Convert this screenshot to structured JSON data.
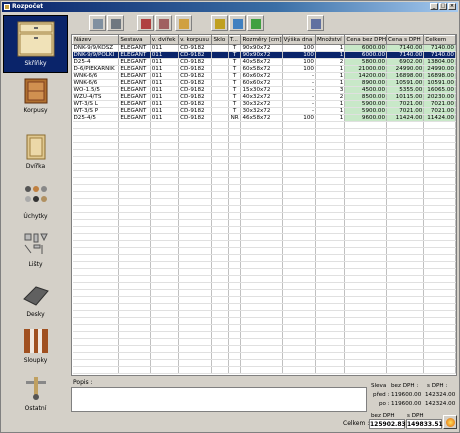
{
  "window": {
    "title": "Rozpočet"
  },
  "sidebar": {
    "items": [
      {
        "label": "Skříňky",
        "active": true
      },
      {
        "label": "Korpusy"
      },
      {
        "label": "Dvířka"
      },
      {
        "label": "Úchytky"
      },
      {
        "label": "Lišty"
      },
      {
        "label": "Desky"
      },
      {
        "label": "Sloupky"
      },
      {
        "label": "Ostatní"
      }
    ]
  },
  "table": {
    "columns": [
      "Název",
      "Sestava",
      "v. dvířek",
      "v. korpusu",
      "Sklo",
      "T...",
      "Rozměry [cm]",
      "Výška dna",
      "Množství",
      "Cena bez DPH",
      "Cena s DPH",
      "Celkem"
    ],
    "rows": [
      [
        "DNK-9/9/KOSZ",
        "ELEGANT",
        "011",
        "CD-9182",
        "",
        "T",
        "90x90x72",
        "100",
        "1",
        "6000.00",
        "7140.00",
        "7140.00"
      ],
      [
        "DNK-9/9/POLKI",
        "ELEGANT",
        "011",
        "CD-9182",
        "",
        "T",
        "90x90x72",
        "100",
        "1",
        "6000.00",
        "7140.00",
        "7140.00"
      ],
      [
        "D25-4",
        "ELEGANT",
        "011",
        "CD-9182",
        "",
        "T",
        "40x58x72",
        "100",
        "2",
        "5800.00",
        "6902.00",
        "13804.00"
      ],
      [
        "D-6/PIEKARNIK",
        "ELEGANT",
        "011",
        "CD-9182",
        "",
        "T",
        "60x58x72",
        "100",
        "1",
        "21000.00",
        "24990.00",
        "24990.00"
      ],
      [
        "WNK-6/6",
        "ELEGANT",
        "011",
        "CD-9182",
        "",
        "T",
        "60x60x72",
        "-",
        "1",
        "14200.00",
        "16898.00",
        "16898.00"
      ],
      [
        "WNK-6/6",
        "ELEGANT",
        "011",
        "CD-9182",
        "",
        "T",
        "60x60x72",
        "-",
        "1",
        "8900.00",
        "10591.00",
        "10591.00"
      ],
      [
        "WO-1.5/5",
        "ELEGANT",
        "011",
        "CD-9182",
        "",
        "T",
        "15x30x72",
        "-",
        "3",
        "4500.00",
        "5355.00",
        "16065.00"
      ],
      [
        "WZU-4/TS",
        "ELEGANT",
        "011",
        "CD-9182",
        "",
        "T",
        "40x32x72",
        "-",
        "2",
        "8500.00",
        "10115.00",
        "20230.00"
      ],
      [
        "WT-3/S L",
        "ELEGANT",
        "011",
        "CD-9182",
        "",
        "T",
        "30x32x72",
        "-",
        "1",
        "5900.00",
        "7021.00",
        "7021.00"
      ],
      [
        "WT-3/S P",
        "ELEGANT",
        "011",
        "CD-9182",
        "",
        "T",
        "30x32x72",
        "-",
        "1",
        "5900.00",
        "7021.00",
        "7021.00"
      ],
      [
        "D25-4/5",
        "ELEGANT",
        "011",
        "CD-9182",
        "",
        "NR",
        "46x58x72",
        "100",
        "1",
        "9600.00",
        "11424.00",
        "11424.00"
      ]
    ],
    "selected_row": 1
  },
  "bottom": {
    "note_label": "Popis :",
    "summary": {
      "sleva_label": "Sleva",
      "bez_dph_label": "bez DPH :",
      "s_dph_label": "s DPH :",
      "pred_label": "před :",
      "pred_bez": "119600.00",
      "pred_s": "142324.00",
      "po_label": "po :",
      "po_bez": "119600.00",
      "po_s": "142324.00"
    }
  },
  "status": {
    "celkem_label": "Celkem :",
    "bez_dph_label": "bez DPH",
    "s_dph_label": "s DPH",
    "bez_dph_value": "125902.83",
    "s_dph_value": "149833.51"
  }
}
